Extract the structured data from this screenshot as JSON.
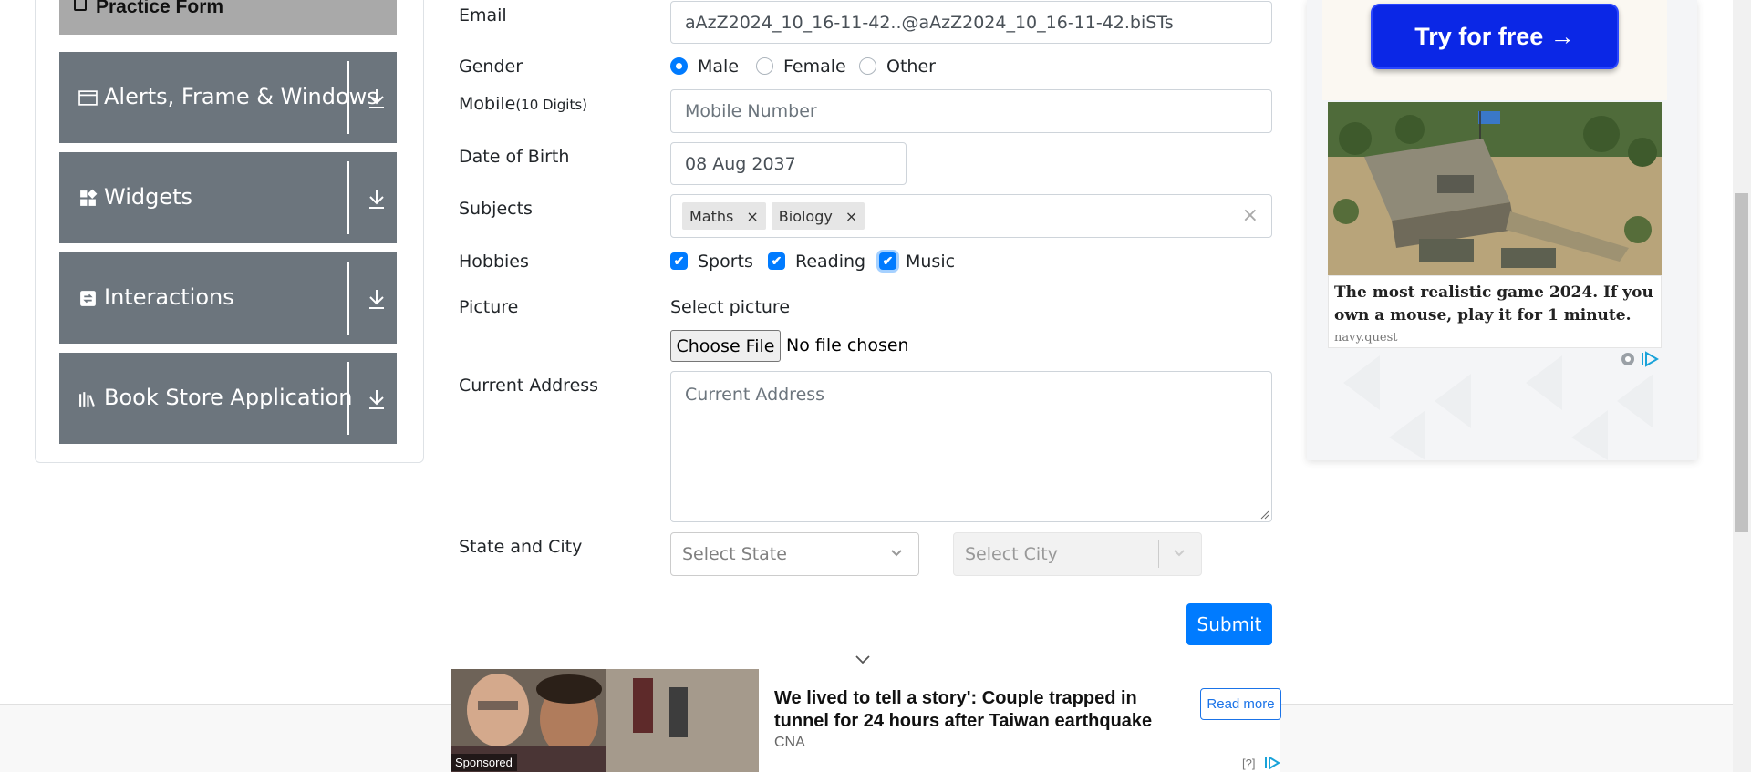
{
  "sidebar": {
    "practice_form_label": "Practice Form",
    "groups": [
      {
        "title": "Alerts, Frame & Windows",
        "icon": "window-icon"
      },
      {
        "title": "Widgets",
        "icon": "widgets-icon"
      },
      {
        "title": "Interactions",
        "icon": "interactions-icon"
      },
      {
        "title": "Book Store Application",
        "icon": "books-icon"
      }
    ]
  },
  "form": {
    "email": {
      "label": "Email",
      "value": "aAzZ2024_10_16-11-42..@aAzZ2024_10_16-11-42.biSTs"
    },
    "gender": {
      "label": "Gender",
      "options": [
        "Male",
        "Female",
        "Other"
      ],
      "selected": "Male"
    },
    "mobile": {
      "label": "Mobile",
      "hint": "(10 Digits)",
      "placeholder": "Mobile Number"
    },
    "dob": {
      "label": "Date of Birth",
      "value": "08 Aug 2037"
    },
    "subjects": {
      "label": "Subjects",
      "chips": [
        "Maths",
        "Biology"
      ],
      "clear": "×",
      "remove": "×"
    },
    "hobbies": {
      "label": "Hobbies",
      "options": [
        "Sports",
        "Reading",
        "Music"
      ],
      "checked": [
        "Sports",
        "Reading",
        "Music"
      ],
      "checkmark": "✔"
    },
    "picture": {
      "label": "Picture",
      "select_text": "Select picture",
      "button": "Choose File",
      "status": "No file chosen"
    },
    "address": {
      "label": "Current Address",
      "placeholder": "Current Address"
    },
    "state_city": {
      "label": "State and City",
      "state_placeholder": "Select State",
      "city_placeholder": "Select City"
    },
    "submit": "Submit"
  },
  "right_ad": {
    "button": "Try for free →",
    "text": "The most realistic game 2024. If you own a mouse, play it for 1 minute.",
    "source": "navy.quest"
  },
  "bottom_ad": {
    "title": "We lived to tell a story': Couple trapped in tunnel for 24 hours after Taiwan earthquake",
    "source": "CNA",
    "button": "Read more",
    "sponsored": "Sponsored",
    "help": "[?]"
  },
  "colors": {
    "primary": "#007bff",
    "sidebar_group": "#6c757d",
    "ad_button": "#0b27e6"
  }
}
